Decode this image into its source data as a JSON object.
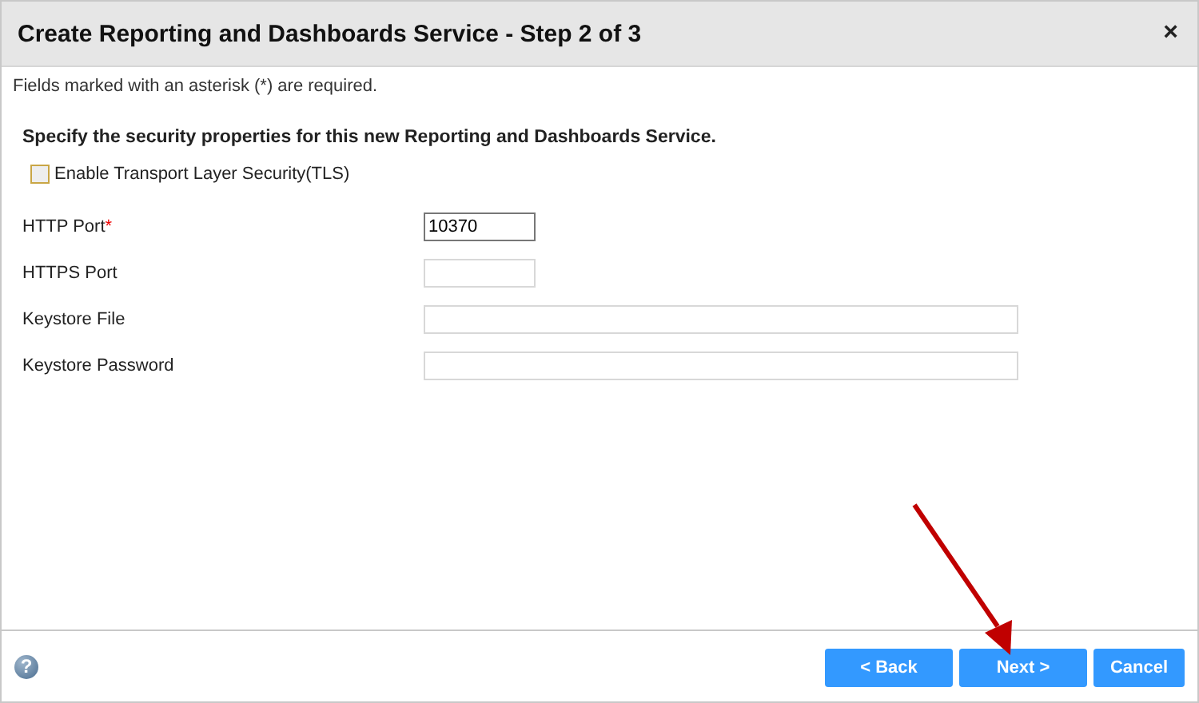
{
  "window": {
    "title": "Create Reporting and Dashboards Service - Step 2 of 3",
    "close": "×"
  },
  "required_note": "Fields marked with an asterisk (*) are required.",
  "heading": "Specify the security properties for this new Reporting and Dashboards Service.",
  "tls_checkbox": {
    "label": "Enable Transport Layer Security(TLS)",
    "checked": false
  },
  "fields": [
    {
      "label": "HTTP Port",
      "required_mark": "*",
      "value": "10370",
      "kind": "short",
      "focused": true
    },
    {
      "label": "HTTPS Port",
      "kind": "short",
      "focused": false
    },
    {
      "label": "Keystore File",
      "kind": "long",
      "focused": false
    },
    {
      "label": "Keystore Password",
      "kind": "long",
      "focused": false
    }
  ],
  "help": "?",
  "buttons": [
    "< Back",
    "Next >",
    "Cancel"
  ]
}
